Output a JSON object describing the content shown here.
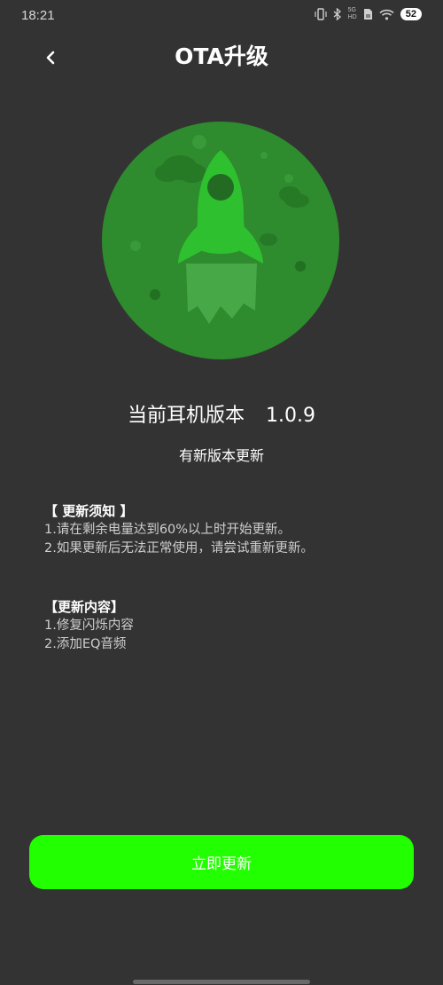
{
  "status_bar": {
    "time": "18:21",
    "network_label_top": "5G",
    "network_label_bottom": "HD",
    "battery": "52",
    "icons": [
      "vibrate-icon",
      "bluetooth-icon",
      "network-icon",
      "file-icon",
      "wifi-icon",
      "battery-icon"
    ]
  },
  "header": {
    "title": "OTA升级",
    "back_icon": "chevron-left-icon"
  },
  "illustration": {
    "icon": "rocket-icon",
    "circle_color": "#2e8b2e",
    "rocket_color": "#2fc02f"
  },
  "version": {
    "label": "当前耳机版本",
    "number": "1.0.9"
  },
  "update_status": "有新版本更新",
  "notice": {
    "title": "【 更新须知 】",
    "lines": [
      "1.请在剩余电量达到60%以上时开始更新。",
      "2.如果更新后无法正常使用，请尝试重新更新。"
    ]
  },
  "changes": {
    "title": "【更新内容】",
    "lines": [
      "1.修复闪烁内容",
      "2.添加EQ音频"
    ]
  },
  "button": {
    "label": "立即更新",
    "color": "#22ff00"
  },
  "theme": {
    "background": "#333333"
  }
}
